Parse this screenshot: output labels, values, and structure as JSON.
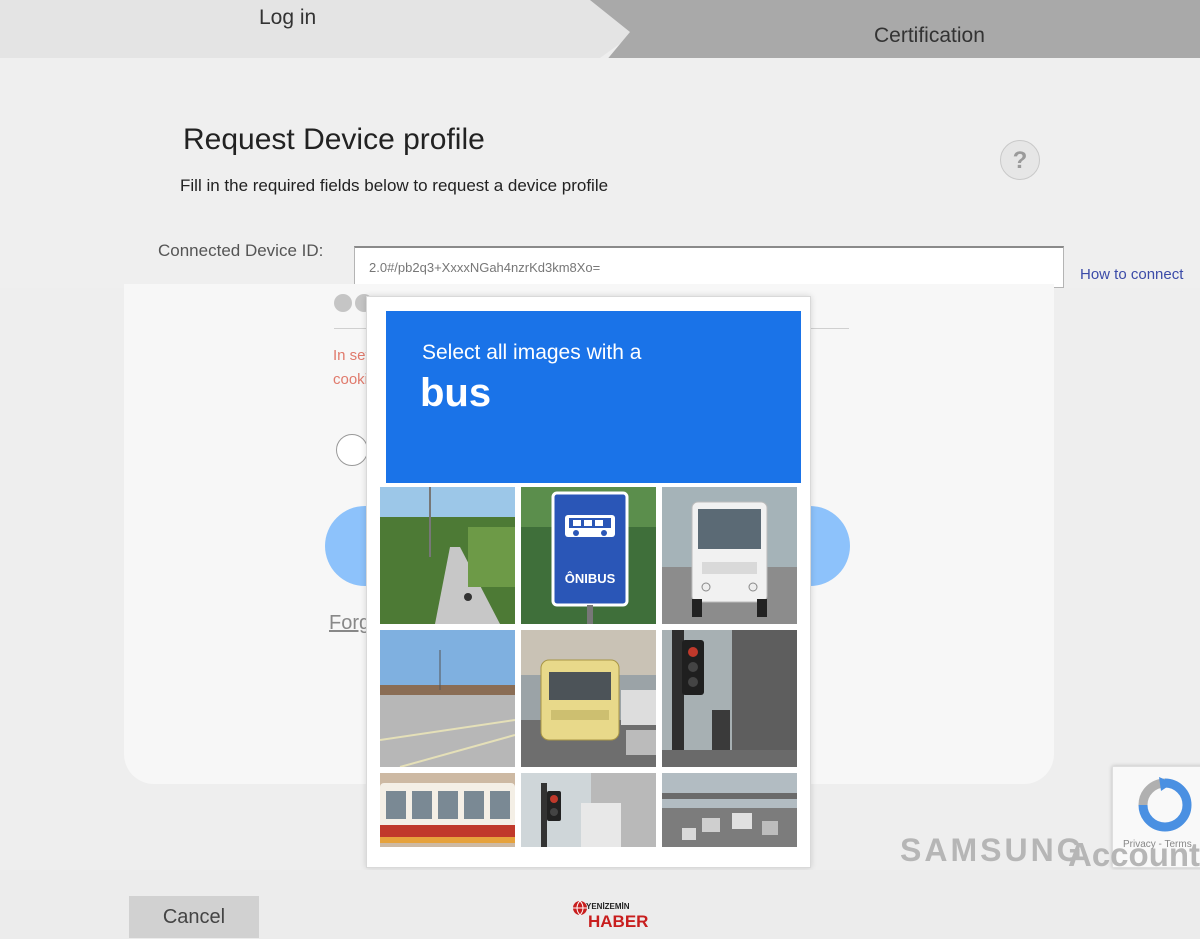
{
  "stepper": {
    "steps": [
      {
        "label": "Log in"
      },
      {
        "label": "Certification"
      }
    ]
  },
  "header": {
    "title": "Request Device profile",
    "subtitle": "Fill in the required fields below to request a device profile",
    "help_icon": "question-mark-icon"
  },
  "device_field": {
    "label": "Connected Device ID:",
    "value": "2.0#/pb2q3+XxxxNGah4nzrKd3km8Xo=",
    "link_text": "How to connect"
  },
  "login_card": {
    "warning_line1": "In set",
    "warning_line2": "cookie",
    "forgot_text": "Forg"
  },
  "captcha": {
    "instruction": "Select all images with a",
    "target": "bus",
    "header_color": "#1a73e8",
    "tiles": [
      {
        "description": "road with motorcyclist and trees"
      },
      {
        "description": "bus stop sign",
        "sign_text": "ÔNIBUS"
      },
      {
        "description": "white bus front"
      },
      {
        "description": "empty parking lot"
      },
      {
        "description": "yellow minibus on street"
      },
      {
        "description": "traffic light on city street"
      },
      {
        "description": "red and white city bus"
      },
      {
        "description": "traffic light by buildings"
      },
      {
        "description": "highway traffic"
      }
    ]
  },
  "branding": {
    "recaptcha_links": "Privacy - Terms",
    "samsung": "SAMSUNG",
    "account": "Account"
  },
  "footer": {
    "cancel_label": "Cancel"
  },
  "watermark": {
    "top": "YENİZEMİN",
    "bottom": "HABER"
  }
}
